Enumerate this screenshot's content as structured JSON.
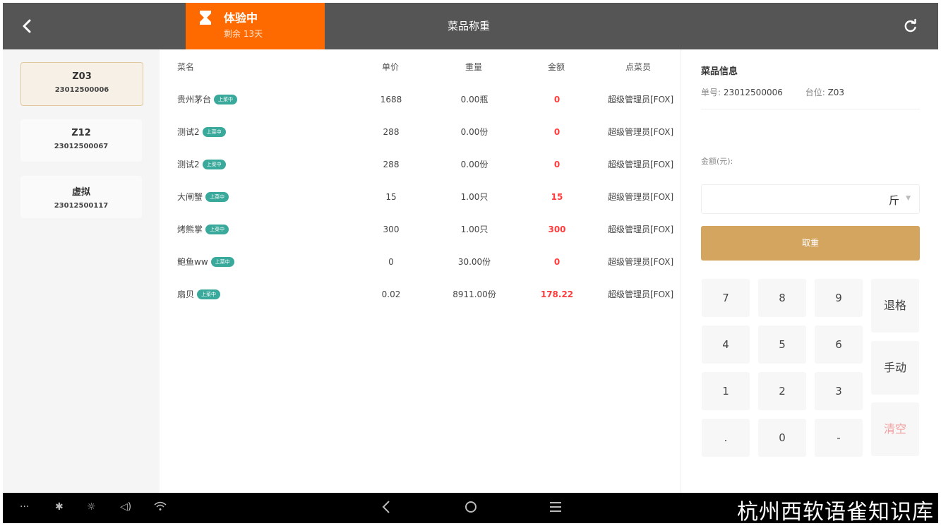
{
  "header": {
    "back_label": "‹",
    "trial_title": "体验中",
    "trial_remaining": "剩余 13天",
    "title": "菜品称重",
    "refresh_icon": "refresh-icon"
  },
  "tables": [
    {
      "name": "Z03",
      "order_no": "23012500006",
      "active": true
    },
    {
      "name": "Z12",
      "order_no": "23012500067",
      "active": false
    },
    {
      "name": "虚拟",
      "order_no": "23012500117",
      "active": false
    }
  ],
  "list": {
    "columns": {
      "name": "菜名",
      "price": "单价",
      "weight": "重量",
      "amount": "金额",
      "waiter": "点菜员"
    },
    "tag": "上菜中",
    "rows": [
      {
        "name": "贵州茅台",
        "price": "1688",
        "weight": "0.00瓶",
        "amount": "0",
        "waiter": "超级管理员[FOX]"
      },
      {
        "name": "测试2",
        "price": "288",
        "weight": "0.00份",
        "amount": "0",
        "waiter": "超级管理员[FOX]"
      },
      {
        "name": "测试2",
        "price": "288",
        "weight": "0.00份",
        "amount": "0",
        "waiter": "超级管理员[FOX]"
      },
      {
        "name": "大闸蟹",
        "price": "15",
        "weight": "1.00只",
        "amount": "15",
        "waiter": "超级管理员[FOX]"
      },
      {
        "name": "烤熊掌",
        "price": "300",
        "weight": "1.00只",
        "amount": "300",
        "waiter": "超级管理员[FOX]"
      },
      {
        "name": "鲍鱼ww",
        "price": "0",
        "weight": "30.00份",
        "amount": "0",
        "waiter": "超级管理员[FOX]"
      },
      {
        "name": "扇贝",
        "price": "0.02",
        "weight": "8911.00份",
        "amount": "178.22",
        "waiter": "超级管理员[FOX]"
      }
    ]
  },
  "info": {
    "title": "菜品信息",
    "order_label": "单号:",
    "order_value": "23012500006",
    "seat_label": "台位:",
    "seat_value": "Z03",
    "amount_label": "金额(元):",
    "unit": "斤",
    "weigh_button": "取重"
  },
  "keypad": {
    "k7": "7",
    "k8": "8",
    "k9": "9",
    "backspace": "退格",
    "k4": "4",
    "k5": "5",
    "k6": "6",
    "manual": "手动",
    "k1": "1",
    "k2": "2",
    "k3": "3",
    "clear": "清空",
    "dot": ".",
    "k0": "0",
    "minus": "-"
  },
  "watermark": "杭州西软语雀知识库",
  "colors": {
    "accent_orange": "#ff6a00",
    "gold": "#d4a55f",
    "tag_green": "#39a99b",
    "amount_red": "#ff3b3b"
  }
}
